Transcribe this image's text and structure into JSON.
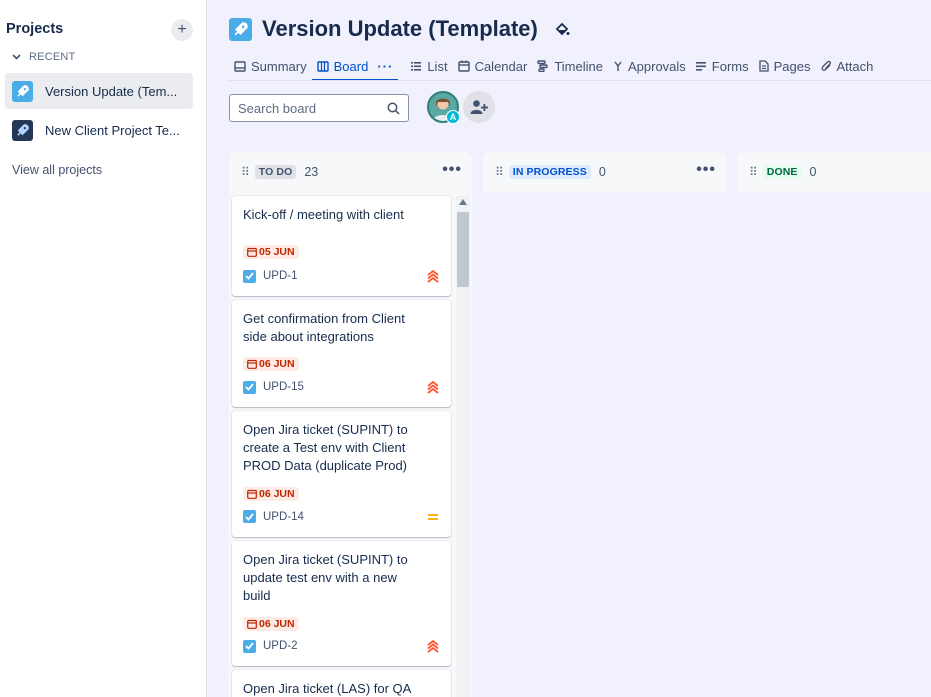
{
  "sidebar": {
    "heading": "Projects",
    "add_label": "+",
    "recent_label": "RECENT",
    "projects": [
      {
        "name": "Version Update (Tem..."
      },
      {
        "name": "New Client Project Te..."
      }
    ],
    "view_all": "View all projects"
  },
  "header": {
    "title": "Version Update (Template)"
  },
  "tabs": [
    {
      "label": "Summary"
    },
    {
      "label": "Board",
      "more": "···"
    },
    {
      "label": "List"
    },
    {
      "label": "Calendar"
    },
    {
      "label": "Timeline"
    },
    {
      "label": "Approvals"
    },
    {
      "label": "Forms"
    },
    {
      "label": "Pages"
    },
    {
      "label": "Attach"
    }
  ],
  "toolbar": {
    "search_placeholder": "Search board",
    "avatar_badge": "A"
  },
  "columns": [
    {
      "title": "TO DO",
      "count": "23",
      "title_color": "#42526e",
      "title_bg": "#dfe1e6"
    },
    {
      "title": "IN PROGRESS",
      "count": "0",
      "title_color": "#0052cc",
      "title_bg": "#deebff"
    },
    {
      "title": "DONE",
      "count": "0",
      "title_color": "#006644",
      "title_bg": "#e3fcef"
    }
  ],
  "cards": [
    {
      "title": "Kick-off / meeting with client",
      "due": "05 JUN",
      "key": "UPD-1",
      "priority": "highest"
    },
    {
      "title": "Get confirmation from Client side about integrations",
      "due": "06 JUN",
      "key": "UPD-15",
      "priority": "highest"
    },
    {
      "title": "Open Jira ticket (SUPINT) to create a Test env with Client PROD Data (duplicate Prod)",
      "due": "06 JUN",
      "key": "UPD-14",
      "priority": "medium"
    },
    {
      "title": "Open Jira ticket (SUPINT) to update test env with a new build",
      "due": "06 JUN",
      "key": "UPD-2",
      "priority": "highest"
    },
    {
      "title": "Open Jira ticket (LAS) for QA"
    }
  ],
  "colors": {
    "accent": "#0052cc",
    "due_bg": "#ffebe6",
    "due_text": "#bf2600",
    "priority_high": "#ff5630",
    "priority_medium": "#ffab00"
  }
}
